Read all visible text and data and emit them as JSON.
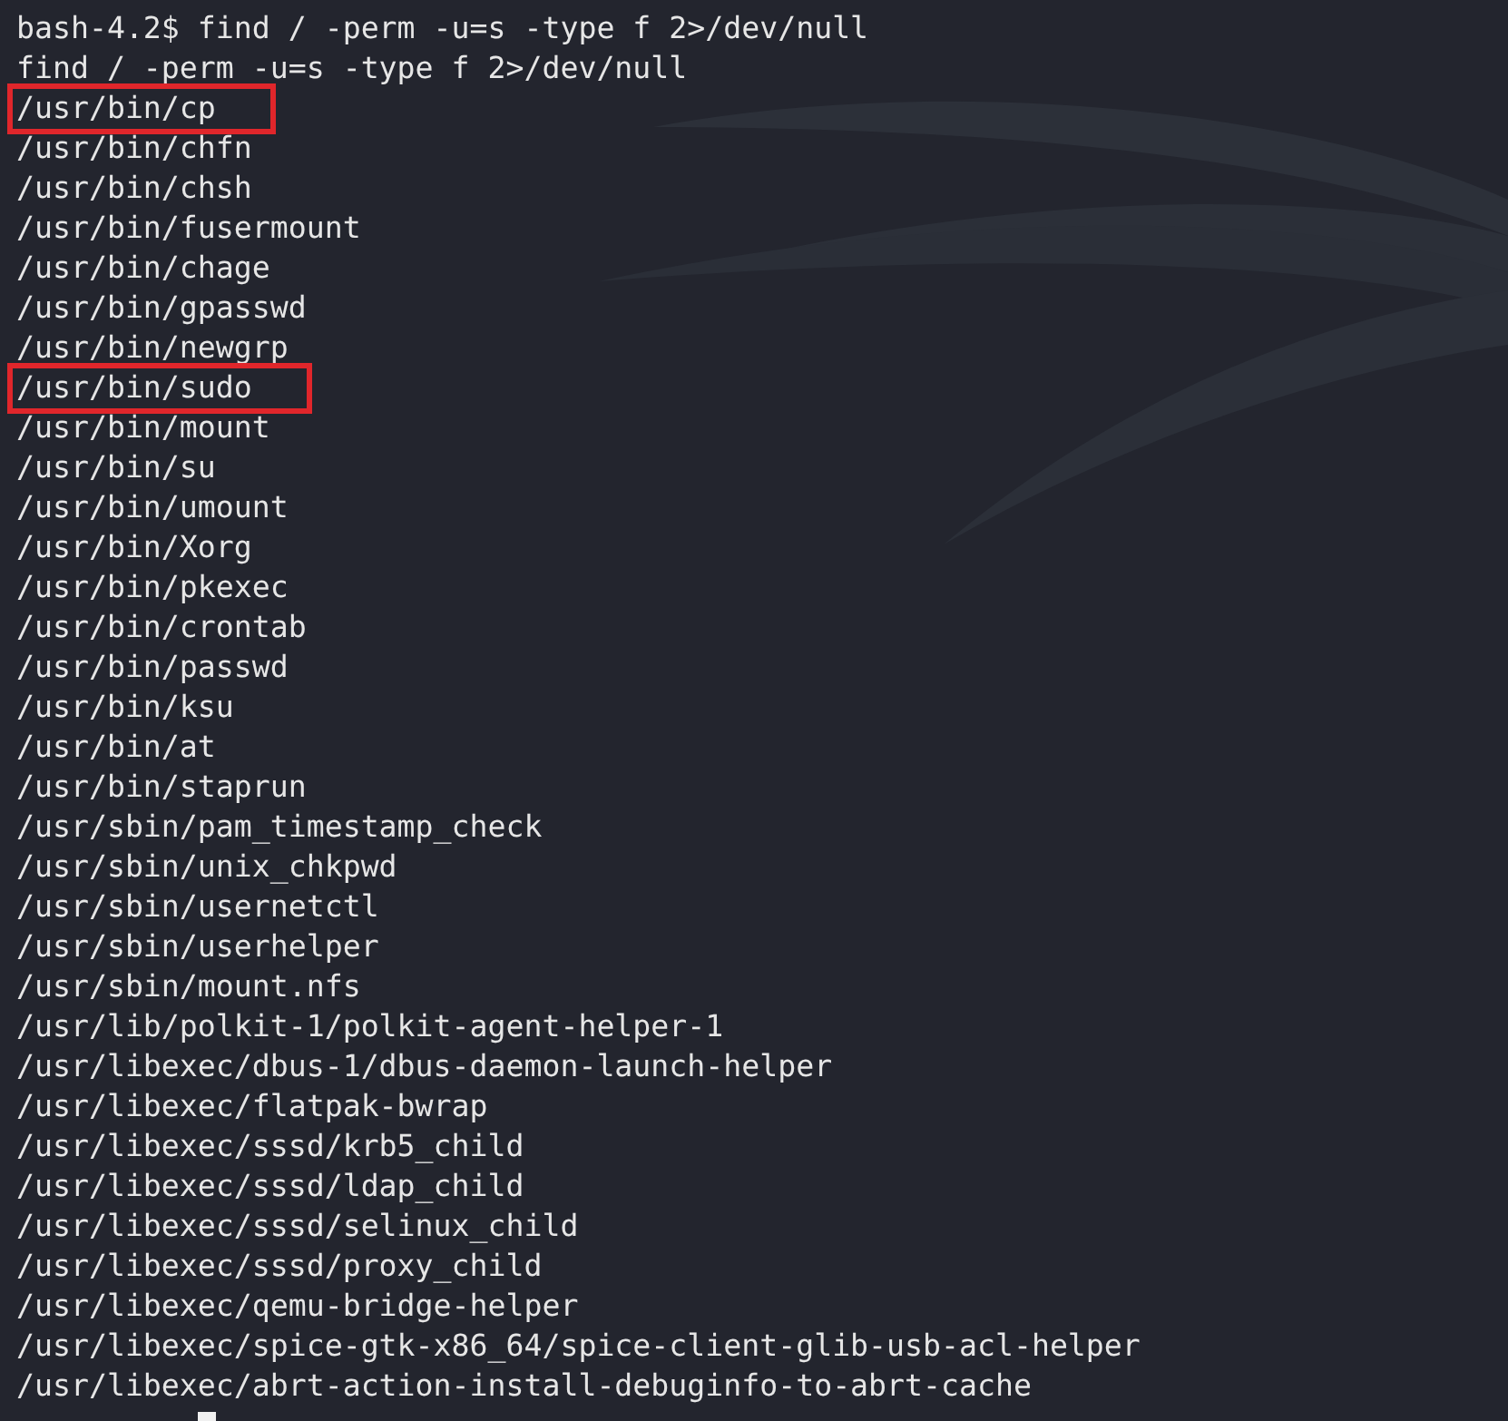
{
  "terminal": {
    "lines": [
      {
        "text": "bash-4.2$ find / -perm -u=s -type f 2>/dev/null",
        "highlighted": false
      },
      {
        "text": "find / -perm -u=s -type f 2>/dev/null",
        "highlighted": false
      },
      {
        "text": "/usr/bin/cp",
        "highlighted": true
      },
      {
        "text": "/usr/bin/chfn",
        "highlighted": false
      },
      {
        "text": "/usr/bin/chsh",
        "highlighted": false
      },
      {
        "text": "/usr/bin/fusermount",
        "highlighted": false
      },
      {
        "text": "/usr/bin/chage",
        "highlighted": false
      },
      {
        "text": "/usr/bin/gpasswd",
        "highlighted": false
      },
      {
        "text": "/usr/bin/newgrp",
        "highlighted": false
      },
      {
        "text": "/usr/bin/sudo",
        "highlighted": true
      },
      {
        "text": "/usr/bin/mount",
        "highlighted": false
      },
      {
        "text": "/usr/bin/su",
        "highlighted": false
      },
      {
        "text": "/usr/bin/umount",
        "highlighted": false
      },
      {
        "text": "/usr/bin/Xorg",
        "highlighted": false
      },
      {
        "text": "/usr/bin/pkexec",
        "highlighted": false
      },
      {
        "text": "/usr/bin/crontab",
        "highlighted": false
      },
      {
        "text": "/usr/bin/passwd",
        "highlighted": false
      },
      {
        "text": "/usr/bin/ksu",
        "highlighted": false
      },
      {
        "text": "/usr/bin/at",
        "highlighted": false
      },
      {
        "text": "/usr/bin/staprun",
        "highlighted": false
      },
      {
        "text": "/usr/sbin/pam_timestamp_check",
        "highlighted": false
      },
      {
        "text": "/usr/sbin/unix_chkpwd",
        "highlighted": false
      },
      {
        "text": "/usr/sbin/usernetctl",
        "highlighted": false
      },
      {
        "text": "/usr/sbin/userhelper",
        "highlighted": false
      },
      {
        "text": "/usr/sbin/mount.nfs",
        "highlighted": false
      },
      {
        "text": "/usr/lib/polkit-1/polkit-agent-helper-1",
        "highlighted": false
      },
      {
        "text": "/usr/libexec/dbus-1/dbus-daemon-launch-helper",
        "highlighted": false
      },
      {
        "text": "/usr/libexec/flatpak-bwrap",
        "highlighted": false
      },
      {
        "text": "/usr/libexec/sssd/krb5_child",
        "highlighted": false
      },
      {
        "text": "/usr/libexec/sssd/ldap_child",
        "highlighted": false
      },
      {
        "text": "/usr/libexec/sssd/selinux_child",
        "highlighted": false
      },
      {
        "text": "/usr/libexec/sssd/proxy_child",
        "highlighted": false
      },
      {
        "text": "/usr/libexec/qemu-bridge-helper",
        "highlighted": false
      },
      {
        "text": "/usr/libexec/spice-gtk-x86_64/spice-client-glib-usb-acl-helper",
        "highlighted": false
      },
      {
        "text": "/usr/libexec/abrt-action-install-debuginfo-to-abrt-cache",
        "highlighted": false
      }
    ]
  }
}
